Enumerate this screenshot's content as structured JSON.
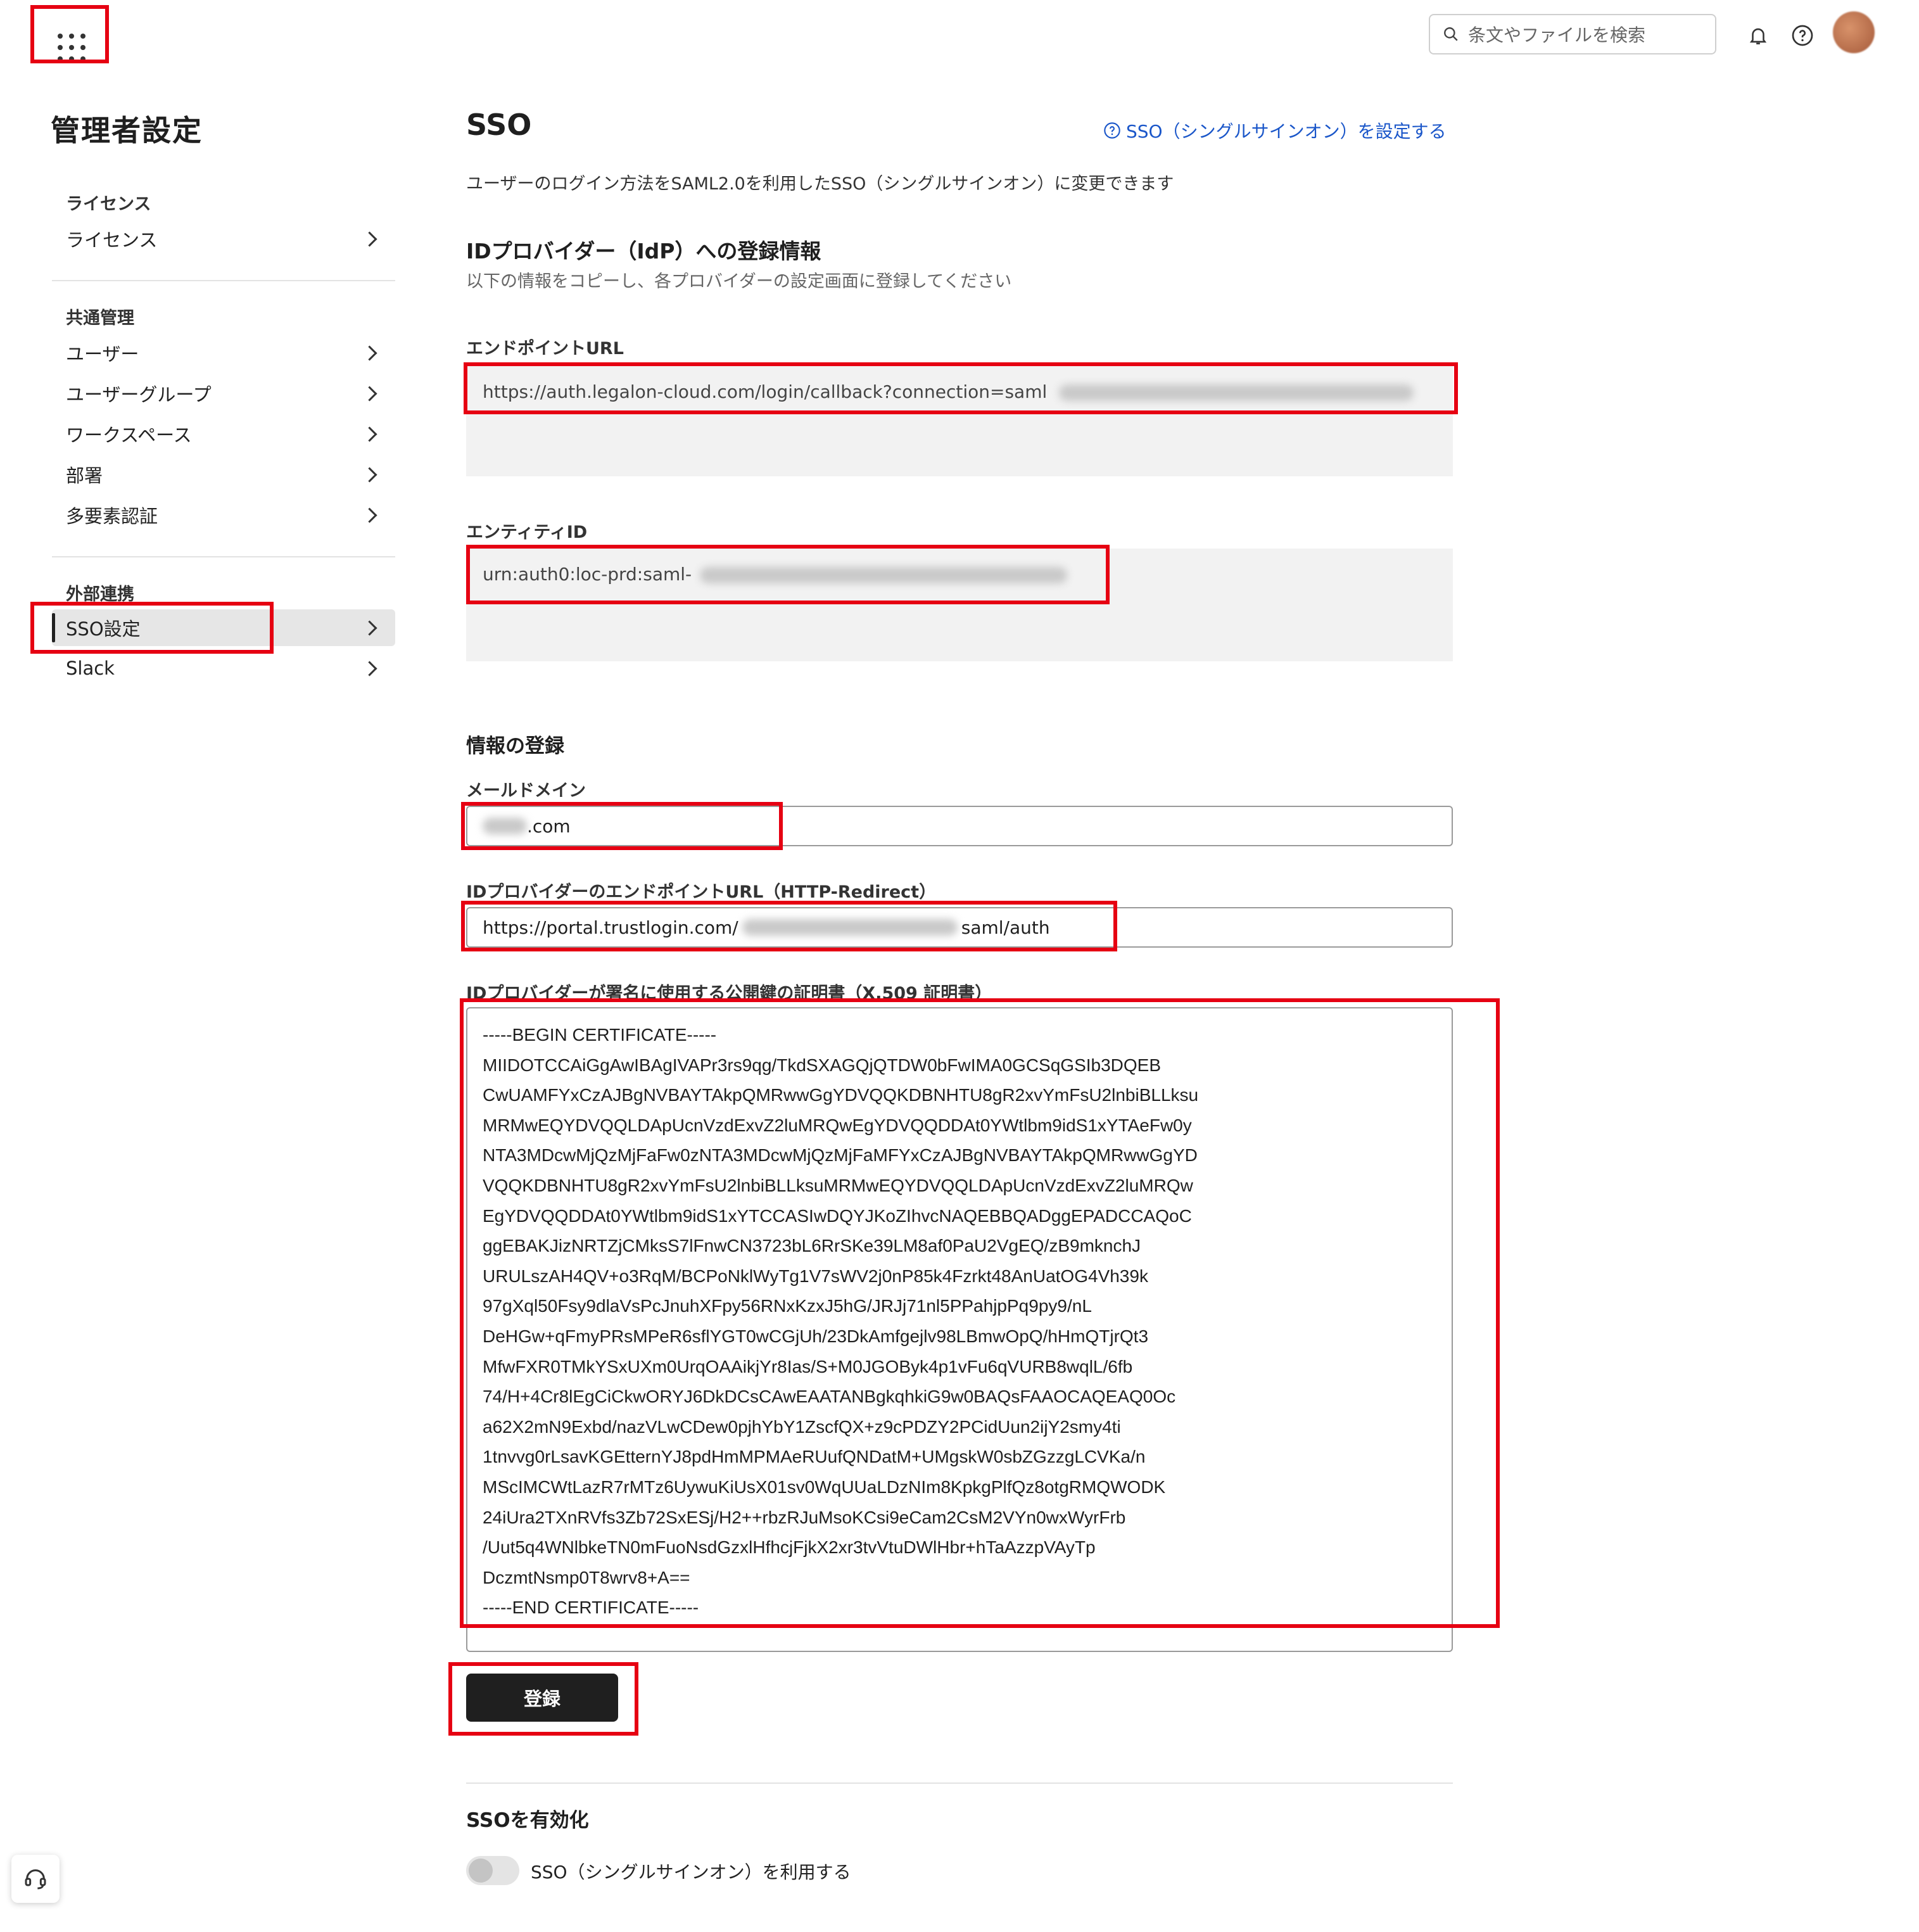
{
  "header": {
    "search_placeholder": "条文やファイルを検索",
    "icons": [
      "apps-grid-icon",
      "search-icon",
      "bell-icon",
      "help-icon",
      "avatar"
    ]
  },
  "sidebar": {
    "title": "管理者設定",
    "sections": [
      {
        "heading": "ライセンス",
        "items": [
          {
            "label": "ライセンス"
          }
        ]
      },
      {
        "heading": "共通管理",
        "items": [
          {
            "label": "ユーザー"
          },
          {
            "label": "ユーザーグループ"
          },
          {
            "label": "ワークスペース"
          },
          {
            "label": "部署"
          },
          {
            "label": "多要素認証"
          }
        ]
      },
      {
        "heading": "外部連携",
        "items": [
          {
            "label": "SSO設定",
            "active": true
          },
          {
            "label": "Slack"
          }
        ]
      }
    ]
  },
  "main": {
    "title": "SSO",
    "help_link": "SSO（シングルサインオン）を設定する",
    "description": "ユーザーのログイン方法をSAML2.0を利用したSSO（シングルサインオン）に変更できます",
    "idp_section": {
      "heading": "IDプロバイダー（IdP）への登録情報",
      "subheading": "以下の情報をコピーし、各プロバイダーの設定画面に登録してください",
      "endpoint_label": "エンドポイントURL",
      "endpoint_value": "https://auth.legalon-cloud.com/login/callback?connection=saml",
      "entity_label": "エンティティID",
      "entity_value": "urn:auth0:loc-prd:saml-"
    },
    "register_section": {
      "heading": "情報の登録",
      "mail_domain_label": "メールドメイン",
      "mail_domain_value": ".com",
      "idp_endpoint_label": "IDプロバイダーのエンドポイントURL（HTTP-Redirect）",
      "idp_endpoint_prefix": "https://portal.trustlogin.com/",
      "idp_endpoint_suffix": "saml/auth",
      "cert_label": "IDプロバイダーが署名に使用する公開鍵の証明書（X.509 証明書）",
      "cert_lines": [
        "-----BEGIN CERTIFICATE-----",
        "MIIDOTCCAiGgAwIBAgIVAPr3rs9qg/TkdSXAGQjQTDW0bFwIMA0GCSqGSIb3DQEB",
        "CwUAMFYxCzAJBgNVBAYTAkpQMRwwGgYDVQQKDBNHTU8gR2xvYmFsU2lnbiBLLksu",
        "MRMwEQYDVQQLDApUcnVzdExvZ2luMRQwEgYDVQQDDAt0YWtlbm9idS1xYTAeFw0y",
        "NTA3MDcwMjQzMjFaFw0zNTA3MDcwMjQzMjFaMFYxCzAJBgNVBAYTAkpQMRwwGgYD",
        "VQQKDBNHTU8gR2xvYmFsU2lnbiBLLksuMRMwEQYDVQQLDApUcnVzdExvZ2luMRQw",
        "EgYDVQQDDAt0YWtlbm9idS1xYTCCASIwDQYJKoZIhvcNAQEBBQADggEPADCCAQoC",
        "ggEBAKJizNRTZjCMksS7lFnwCN3723bL6RrSKe39LM8af0PaU2VgEQ/zB9mknchJ",
        "URULszAH4QV+o3RqM/BCPoNklWyTg1V7sWV2j0nP85k4Fzrkt48AnUatOG4Vh39k",
        "97gXql50Fsy9dlaVsPcJnuhXFpy56RNxKzxJ5hG/JRJj71nl5PPahjpPq9py9/nL",
        "DeHGw+qFmyPRsMPeR6sflYGT0wCGjUh/23DkAmfgejlv98LBmwOpQ/hHmQTjrQt3",
        "MfwFXR0TMkYSxUXm0UrqOAAikjYr8Ias/S+M0JGOByk4p1vFu6qVURB8wqlL/6fb",
        "74/H+4Cr8lEgCiCkwORYJ6DkDCsCAwEAATANBgkqhkiG9w0BAQsFAAOCAQEAQ0Oc",
        "a62X2mN9Exbd/nazVLwCDew0pjhYbY1ZscfQX+z9cPDZY2PCidUun2ijY2smy4ti",
        "1tnvvg0rLsavKGEtternYJ8pdHmMPMAeRUufQNDatM+UMgskW0sbZGzzgLCVKa/n",
        "MScIMCWtLazR7rMTz6UywuKiUsX01sv0WqUUaLDzNIm8KpkgPlfQz8otgRMQWODK",
        "24iUra2TXnRVfs3Zb72SxESj/H2++rbzRJuMsoKCsi9eCam2CsM2VYn0wxWyrFrb",
        "/Uut5q4WNlbkeTN0mFuoNsdGzxlHfhcjFjkX2xr3tvVtuDWlHbr+hTaAzzpVAyTp",
        "DczmtNsmp0T8wrv8+A==",
        "-----END CERTIFICATE-----"
      ],
      "submit_label": "登録"
    },
    "enable_section": {
      "heading": "SSOを有効化",
      "toggle_label": "SSO（シングルサインオン）を利用する",
      "toggle_on": false
    }
  },
  "colors": {
    "highlight": "#e60012",
    "link": "#1a56c9",
    "button": "#1f1f1f"
  }
}
